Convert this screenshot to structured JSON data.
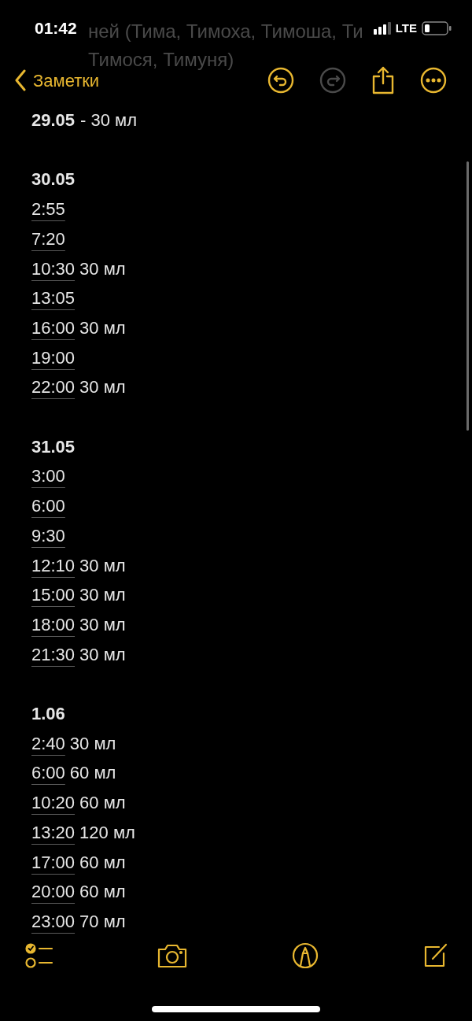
{
  "status_bar": {
    "time": "01:42",
    "network": "LTE"
  },
  "scrolled_title": [
    "ней (Тима, Тимоха, Тимоша, Ти",
    "Тимося, Тимуня)"
  ],
  "nav": {
    "back": "Заметки",
    "undo_disabled": false,
    "redo_disabled": true
  },
  "note": [
    {
      "date": "29.05",
      "suffix": "- 30 мл"
    },
    {
      "date": "30.05",
      "entries": [
        {
          "time": "2:55"
        },
        {
          "time": "7:20"
        },
        {
          "time": "10:30",
          "amount": "30 мл"
        },
        {
          "time": "13:05"
        },
        {
          "time": "16:00",
          "amount": "30 мл"
        },
        {
          "time": "19:00"
        },
        {
          "time": "22:00",
          "amount": "30 мл"
        }
      ]
    },
    {
      "date": "31.05",
      "entries": [
        {
          "time": "3:00"
        },
        {
          "time": "6:00"
        },
        {
          "time": "9:30"
        },
        {
          "time": "12:10",
          "amount": "30 мл"
        },
        {
          "time": "15:00",
          "amount": "30 мл"
        },
        {
          "time": "18:00",
          "amount": "30 мл"
        },
        {
          "time": "21:30",
          "amount": "30 мл"
        }
      ]
    },
    {
      "date": "1.06",
      "entries": [
        {
          "time": "2:40",
          "amount": "30 мл"
        },
        {
          "time": "6:00",
          "amount": "60 мл"
        },
        {
          "time": "10:20",
          "amount": "60 мл"
        },
        {
          "time": "13:20",
          "amount": "120 мл"
        },
        {
          "time": "17:00",
          "amount": "60 мл"
        },
        {
          "time": "20:00",
          "amount": "60 мл"
        },
        {
          "time": "23:00",
          "amount": "70 мл"
        }
      ]
    }
  ]
}
